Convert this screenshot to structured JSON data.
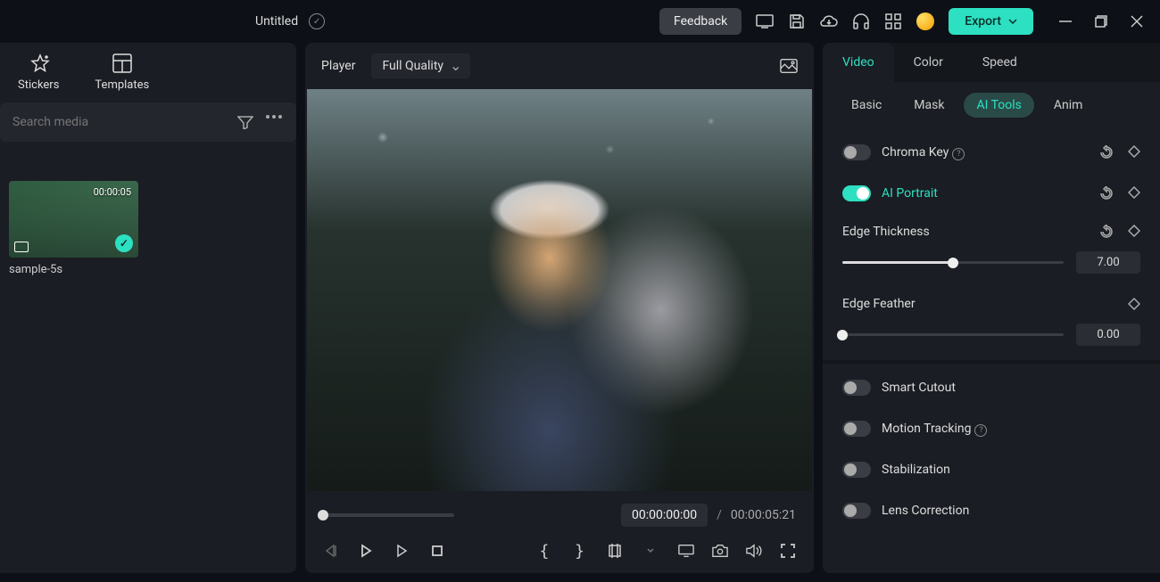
{
  "topbar": {
    "title": "Untitled",
    "feedback": "Feedback",
    "export": "Export"
  },
  "left": {
    "tabs": {
      "stickers": "Stickers",
      "templates": "Templates"
    },
    "search_placeholder": "Search media",
    "thumb_duration": "00:00:05",
    "media_name": "sample-5s"
  },
  "player": {
    "label": "Player",
    "quality": "Full Quality",
    "time_current": "00:00:00:00",
    "time_sep": "/",
    "time_total": "00:00:05:21"
  },
  "props": {
    "tabs": {
      "video": "Video",
      "color": "Color",
      "speed": "Speed"
    },
    "subtabs": {
      "basic": "Basic",
      "mask": "Mask",
      "ai_tools": "AI Tools",
      "anim": "Anim"
    },
    "chroma_key": "Chroma Key",
    "ai_portrait": "AI Portrait",
    "edge_thickness": "Edge Thickness",
    "edge_thickness_value": "7.00",
    "edge_feather": "Edge Feather",
    "edge_feather_value": "0.00",
    "smart_cutout": "Smart Cutout",
    "motion_tracking": "Motion Tracking",
    "stabilization": "Stabilization",
    "lens_correction": "Lens Correction"
  }
}
